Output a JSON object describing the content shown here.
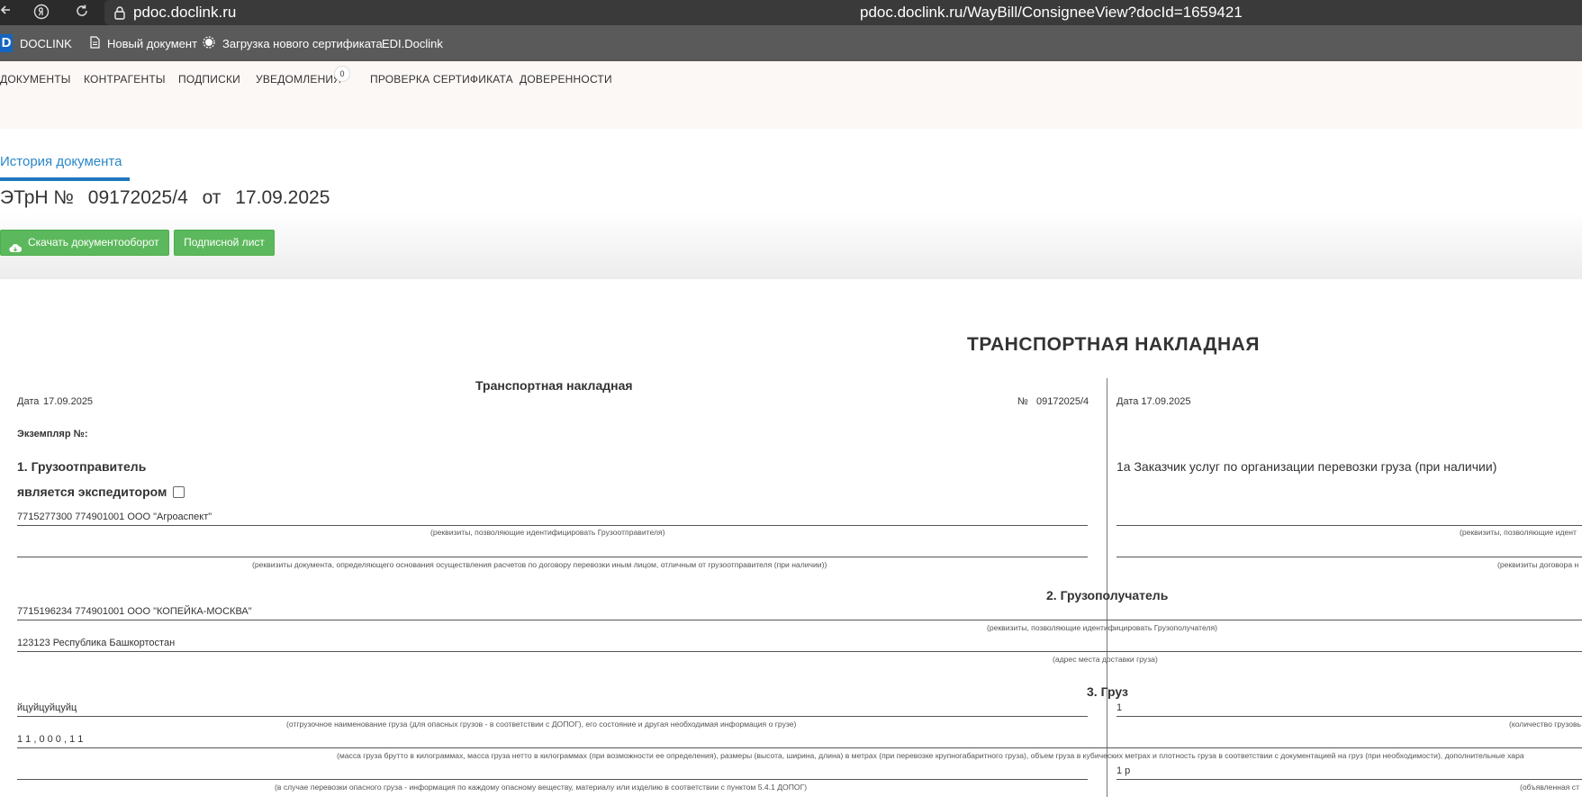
{
  "browser": {
    "url_short": "pdoc.doclink.ru",
    "url_full": "pdoc.doclink.ru/WayBill/ConsigneeView?docId=1659421",
    "icons": [
      "back-icon",
      "yandex-icon",
      "reload-icon",
      "lock-icon"
    ]
  },
  "appbar": {
    "logo_letter": "D",
    "logo_text": "DOCLINK",
    "new_doc": "Новый документ",
    "upload_cert": "Загрузка нового сертификата",
    "edi": "EDI.Doclink"
  },
  "subnav": {
    "items": [
      "ДОКУМЕНТЫ",
      "КОНТРАГЕНТЫ",
      "ПОДПИСКИ",
      "УВЕДОМЛЕНИЯ",
      "ПРОВЕРКА СЕРТИФИКАТА",
      "ДОВЕРЕННОСТИ"
    ],
    "notif_count": "0"
  },
  "doc": {
    "history_tab": "История документа",
    "title_prefix": "ЭТрН №",
    "number": "09172025/4",
    "from": "от",
    "date": "17.09.2025",
    "download_btn": "Скачать документооборот",
    "signature_btn": "Подписной лист"
  },
  "form": {
    "title": "ТРАНСПОРТНАЯ НАКЛАДНАЯ",
    "subtitle": "Транспортная накладная",
    "date_label": "Дата",
    "date_value": "17.09.2025",
    "num_label": "№",
    "num_value": "09172025/4",
    "right_date": "Дата 17.09.2025",
    "copy_label": "Экземпляр №:",
    "shipper_title": "1. Грузоотправитель",
    "forwarder_label": "является экспедитором",
    "shipper_value": "7715277300 774901001 ООО \"Агроаспект\"",
    "shipper_hint": "(реквизиты, позволяющие идентифицировать Грузоотправителя)",
    "settle_hint": "(реквизиты документа, определяющего основания осуществления расчетов по договору перевозки иным лицом, отличным от грузоотправителя (при наличии))",
    "customer_title": "1а Заказчик услуг по организации перевозки груза (при наличии)",
    "customer_hint": "(реквизиты, позволяющие идент",
    "contract_hint": "(реквизиты договора н",
    "consignee_title": "2. Грузополучатель",
    "consignee_value": "7715196234 774901001 ООО \"КОПЕЙКА-МОСКВА\"",
    "consignee_hint": "(реквизиты, позволяющие идентифицировать Грузополучателя)",
    "address_value": "123123 Республика Башкортостан",
    "address_hint": "(адрес места доставки груза)",
    "cargo_title": "3. Груз",
    "cargo_name": "йцуйцуйцуйц",
    "cargo_name_hint": "(отгрузочное наименование груза (для опасных грузов - в соответствии с ДОПОГ), его состояние и другая необходимая информация о грузе)",
    "cargo_qty": "1",
    "cargo_qty_hint": "(количество грузовь",
    "cargo_mass": "1 1 , 0 0 0 , 1 1",
    "cargo_mass_hint": "(масса груза брутто в килограммах, масса груза нетто в килограммах (при возможности ее определения), размеры (высота, ширина, длина) в метрах (при перевозке крупногабаритного груза), объем груза в кубических метрах и плотность груза в соответствии с документацией на груз (при необходимости), дополнительные хара",
    "declared_value": "1 р",
    "declared_hint": "(объявленная ст",
    "dangerous_hint": "(в случае перевозки опасного груза - информация по каждому опасному веществу, материалу или изделию в соответствии с пунктом 5.4.1 ДОПОГ)"
  }
}
